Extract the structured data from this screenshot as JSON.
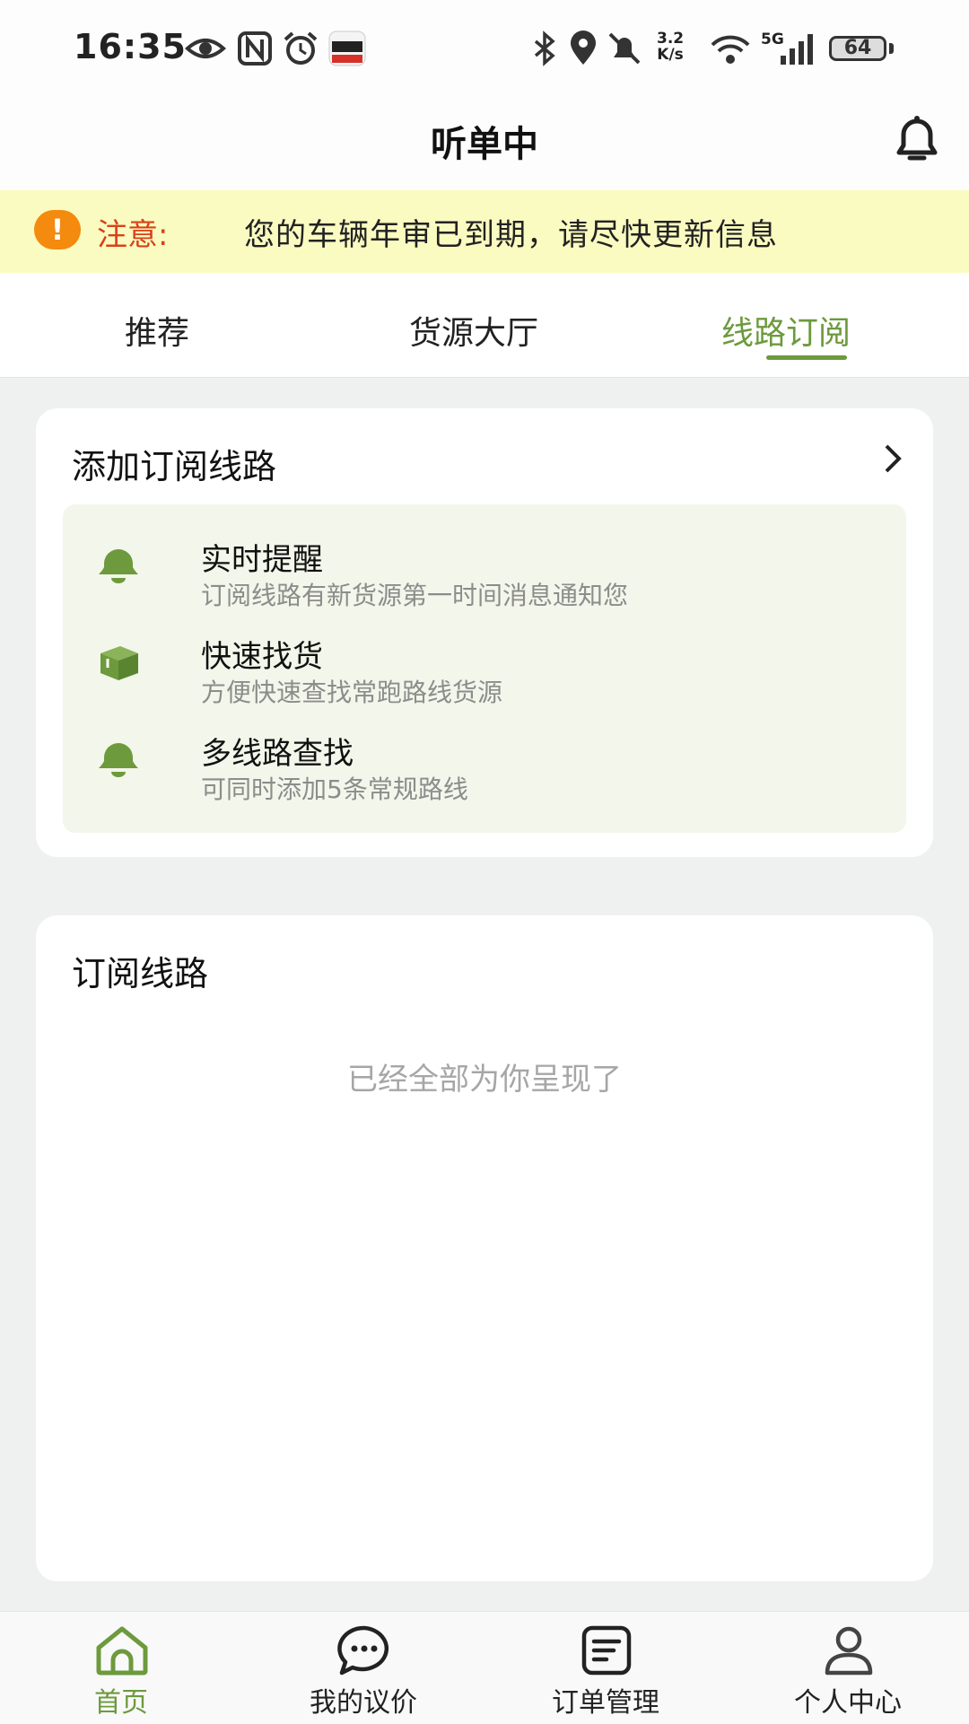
{
  "status_bar": {
    "time": "16:35",
    "net_speed_value": "3.2",
    "net_speed_unit": "K/s",
    "network": "5G",
    "battery": "64",
    "icons": [
      "eye-icon",
      "nfc-icon",
      "alarm-icon",
      "app-notification-icon",
      "bluetooth-icon",
      "location-icon",
      "mute-icon",
      "wifi-icon",
      "signal-icon"
    ]
  },
  "header": {
    "title": "听单中",
    "bell_icon": "bell-icon"
  },
  "notice": {
    "label": "注意:",
    "text": "您的车辆年审已到期，请尽快更新信息",
    "icon_glyph": "!"
  },
  "tabs": [
    {
      "label": "推荐",
      "active": false
    },
    {
      "label": "货源大厅",
      "active": false
    },
    {
      "label": "线路订阅",
      "active": true
    }
  ],
  "add_card": {
    "title": "添加订阅线路",
    "features": [
      {
        "title": "实时提醒",
        "desc": "订阅线路有新货源第一时间消息通知您",
        "icon": "bell-icon"
      },
      {
        "title": "快速找货",
        "desc": "方便快速查找常跑路线货源",
        "icon": "box-icon"
      },
      {
        "title": "多线路查找",
        "desc": "可同时添加5条常规路线",
        "icon": "bell-icon"
      }
    ]
  },
  "list_card": {
    "title": "订阅线路",
    "empty_text": "已经全部为你呈现了"
  },
  "bottom_nav": [
    {
      "label": "首页",
      "icon": "home-icon",
      "active": true
    },
    {
      "label": "我的议价",
      "icon": "chat-icon",
      "active": false
    },
    {
      "label": "订单管理",
      "icon": "orders-icon",
      "active": false
    },
    {
      "label": "个人中心",
      "icon": "user-icon",
      "active": false
    }
  ],
  "colors": {
    "accent": "#6d9a3d",
    "notice_bg": "#fafbc0",
    "notice_label": "#d8421a",
    "warning_icon": "#f48a0e"
  }
}
